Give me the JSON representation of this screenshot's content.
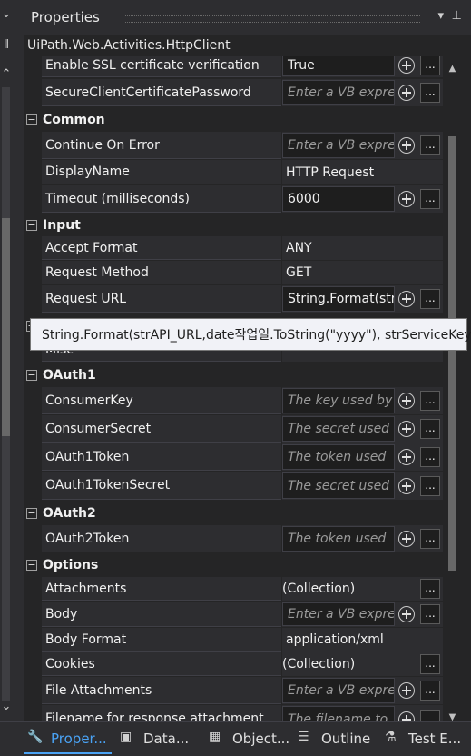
{
  "panel": {
    "title": "Properties",
    "type_name": "UiPath.Web.Activities.HttpClient"
  },
  "rows": {
    "ssl": {
      "name": "Enable SSL certificate verification",
      "value": "True"
    },
    "scc": {
      "name": "SecureClientCertificatePassword",
      "placeholder": "Enter a VB expre"
    },
    "common": {
      "label": "Common"
    },
    "coe": {
      "name": "Continue On Error",
      "placeholder": "Enter a VB expre"
    },
    "display": {
      "name": "DisplayName",
      "value": "HTTP Request"
    },
    "timeout": {
      "name": "Timeout (milliseconds)",
      "value": "6000"
    },
    "input": {
      "label": "Input"
    },
    "accept": {
      "name": "Accept Format",
      "value": "ANY"
    },
    "method": {
      "name": "Request Method",
      "value": "GET"
    },
    "url": {
      "name": "Request URL",
      "value": "String.Format(str"
    },
    "hidden": {
      "name": "Misc"
    },
    "oauth1": {
      "label": "OAuth1"
    },
    "ckey": {
      "name": "ConsumerKey",
      "placeholder": "The key used by"
    },
    "csecret": {
      "name": "ConsumerSecret",
      "placeholder": "The secret used"
    },
    "otoken": {
      "name": "OAuth1Token",
      "placeholder": "The token used"
    },
    "otsecret": {
      "name": "OAuth1TokenSecret",
      "placeholder": "The secret used"
    },
    "oauth2": {
      "label": "OAuth2"
    },
    "o2token": {
      "name": "OAuth2Token",
      "placeholder": "The token used"
    },
    "options": {
      "label": "Options"
    },
    "attach": {
      "name": "Attachments",
      "value": "(Collection)"
    },
    "body": {
      "name": "Body",
      "placeholder": "Enter a VB expre"
    },
    "bformat": {
      "name": "Body Format",
      "value": "application/xml"
    },
    "cookies": {
      "name": "Cookies",
      "value": "(Collection)"
    },
    "fattach": {
      "name": "File Attachments",
      "placeholder": "Enter a VB expre"
    },
    "fname": {
      "name": "Filename for response attachment",
      "placeholder": "The filename to"
    }
  },
  "tooltip": "String.Format(strAPI_URL,date작업일.ToString(\"yyyy\"), strServiceKey)",
  "tabs": [
    {
      "label": "Proper...",
      "icon": "wrench-icon"
    },
    {
      "label": "Data...",
      "icon": "data-icon"
    },
    {
      "label": "Object...",
      "icon": "object-icon"
    },
    {
      "label": "Outline",
      "icon": "outline-icon"
    },
    {
      "label": "Test E...",
      "icon": "test-icon"
    }
  ],
  "icons": {
    "collapse": "⊟",
    "ellipsis": "..."
  }
}
